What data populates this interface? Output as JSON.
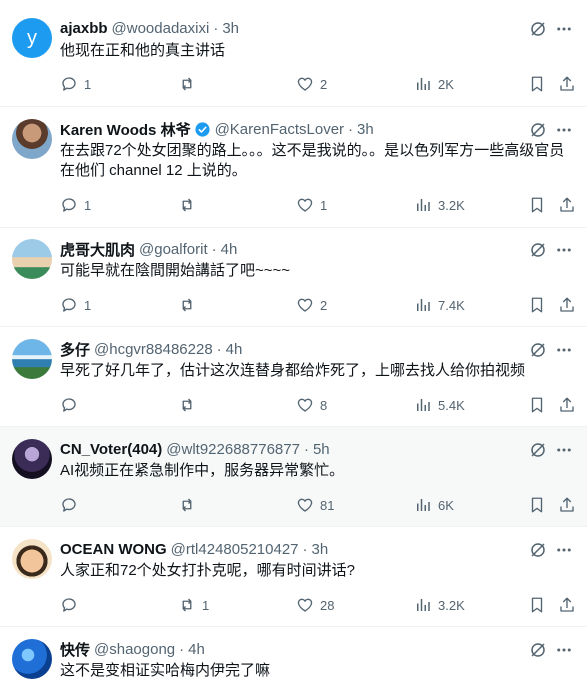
{
  "colors": {
    "text": "#0f1419",
    "secondary": "#536471",
    "divider": "#eff3f4",
    "verified": "#1d9bf0",
    "highlight_bg": "#f7f9f9"
  },
  "icons": [
    "reply-icon",
    "retweet-icon",
    "like-icon",
    "views-icon",
    "bookmark-icon",
    "share-icon",
    "grok-icon",
    "more-icon",
    "verified-icon"
  ],
  "tweets": [
    {
      "name": "ajaxbb",
      "handle": "@woodadaxixi",
      "sep": "·",
      "time": "3h",
      "lines": [
        "他现在正和他的真主讲话"
      ],
      "replies": "1",
      "reposts": "",
      "likes": "2",
      "views": "2K",
      "avatar_letter": "y"
    },
    {
      "name": "Karen Woods 林爷",
      "handle": "@KarenFactsLover",
      "sep": "·",
      "time": "3h",
      "lines": [
        "在去跟72个处女团聚的路上。。。这不是我说的。。是以色列军方一些高级官员",
        "在他们 channel 12 上说的。"
      ],
      "replies": "1",
      "reposts": "",
      "likes": "1",
      "views": "3.2K"
    },
    {
      "name": "虎哥大肌肉",
      "handle": "@goalforit",
      "sep": "·",
      "time": "4h",
      "lines": [
        "可能早就在陰間開始講話了吧~~~~"
      ],
      "replies": "1",
      "reposts": "",
      "likes": "2",
      "views": "7.4K"
    },
    {
      "name": "多仔",
      "handle": "@hcgvr88486228",
      "sep": "·",
      "time": "4h",
      "lines": [
        "早死了好几年了，估计这次连替身都给炸死了，上哪去找人给你拍视频"
      ],
      "replies": "",
      "reposts": "",
      "likes": "8",
      "views": "5.4K"
    },
    {
      "name": "CN_Voter(404)",
      "handle": "@wlt922688776877",
      "sep": "·",
      "time": "5h",
      "lines": [
        "AI视频正在紧急制作中，服务器异常繁忙。"
      ],
      "replies": "",
      "reposts": "",
      "likes": "81",
      "views": "6K"
    },
    {
      "name": "OCEAN WONG",
      "handle": "@rtl424805210427",
      "sep": "·",
      "time": "3h",
      "lines": [
        "人家正和72个处女打扑克呢，哪有时间讲话?"
      ],
      "replies": "",
      "reposts": "1",
      "likes": "28",
      "views": "3.2K"
    },
    {
      "name": "快传",
      "handle": "@shaogong",
      "sep": "·",
      "time": "4h",
      "lines": [
        "这不是变相证实哈梅内伊完了嘛"
      ],
      "replies": "",
      "reposts": "",
      "likes": "",
      "views": ""
    }
  ]
}
